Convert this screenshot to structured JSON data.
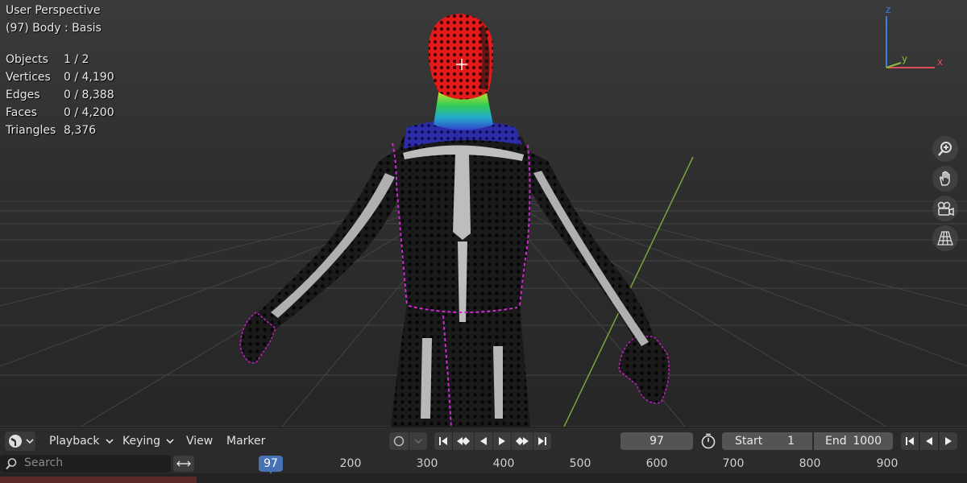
{
  "viewport": {
    "view_name": "User Perspective",
    "object_info": "(97) Body : Basis",
    "stats": [
      {
        "label": "Objects",
        "value": "1 / 2"
      },
      {
        "label": "Vertices",
        "value": "0 / 4,190"
      },
      {
        "label": "Edges",
        "value": "0 / 8,388"
      },
      {
        "label": "Faces",
        "value": "0 / 4,200"
      },
      {
        "label": "Triangles",
        "value": "8,376"
      }
    ],
    "axis_labels": {
      "z": "z",
      "y": "y",
      "x": "x"
    },
    "nav_icons": [
      "zoom-icon",
      "pan-hand-icon",
      "camera-icon",
      "grid-perspective-icon"
    ]
  },
  "timeline": {
    "menus": {
      "playback": "Playback",
      "keying": "Keying",
      "view": "View",
      "marker": "Marker"
    },
    "current_frame": "97",
    "start_label": "Start",
    "start_value": "1",
    "end_label": "End",
    "end_value": "1000",
    "search_placeholder": "Search",
    "ruler_labels": [
      "200",
      "300",
      "400",
      "500",
      "600",
      "700",
      "800",
      "900"
    ],
    "playhead_label": "97"
  },
  "colors": {
    "accent_blue": "#4772b3",
    "axis_x": "#e04b5c",
    "axis_y": "#8bbc3c",
    "axis_z": "#3d7fe0",
    "seam": "#d22ad2"
  }
}
